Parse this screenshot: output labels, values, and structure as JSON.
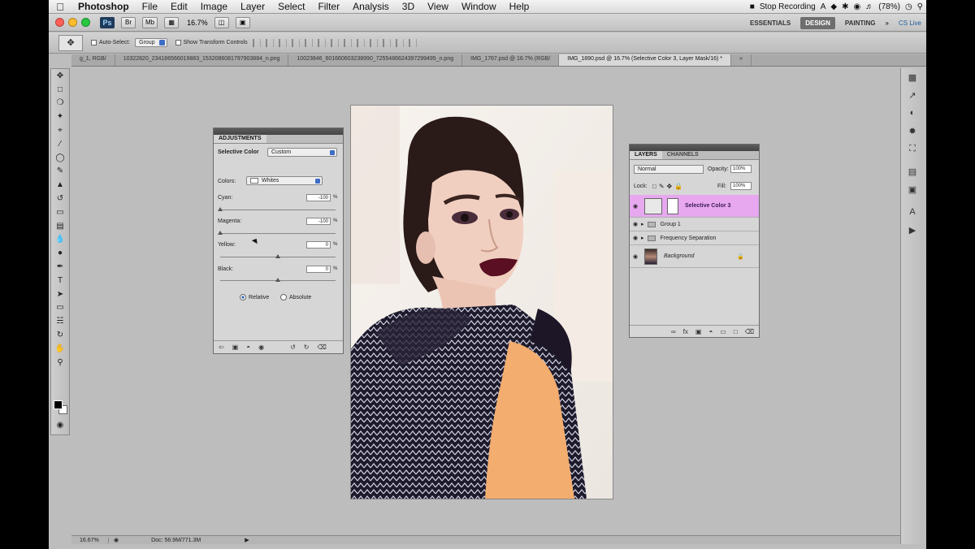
{
  "menubar": {
    "app": "Photoshop",
    "items": [
      "File",
      "Edit",
      "Image",
      "Layer",
      "Select",
      "Filter",
      "Analysis",
      "3D",
      "View",
      "Window",
      "Help"
    ],
    "status": {
      "recording": "Stop Recording",
      "battery": "(78%)"
    }
  },
  "appbar": {
    "ps": "Ps",
    "zoom": "16.7%",
    "workspaces": [
      "ESSENTIALS",
      "DESIGN",
      "PAINTING"
    ],
    "more": "»",
    "cslive": "CS Live"
  },
  "options": {
    "auto_select": "Auto-Select:",
    "group": "Group",
    "show_transform": "Show Transform Controls"
  },
  "tabs": [
    "g_1, RGB/",
    "10322820_234186566019883_1532086081797903884_n.png",
    "10023846_601660603238990_7255486624397299495_n.png",
    "IMG_1767.psd @ 16.7% (RGB/",
    "IMG_1890.psd @ 16.7% (Selective Color 3, Layer Mask/16) *"
  ],
  "adjustments": {
    "tab": "ADJUSTMENTS",
    "title": "Selective Color",
    "preset": "Custom",
    "colors_label": "Colors:",
    "colors_value": "Whites",
    "sliders": [
      {
        "label": "Cyan:",
        "value": "-100",
        "unit": "%",
        "position": 0.0
      },
      {
        "label": "Magenta:",
        "value": "-100",
        "unit": "%",
        "position": 0.0
      },
      {
        "label": "Yellow:",
        "value": "0",
        "unit": "%",
        "position": 0.5
      },
      {
        "label": "Black:",
        "value": "0",
        "unit": "%",
        "position": 0.5
      }
    ],
    "relative": "Relative",
    "absolute": "Absolute"
  },
  "layers": {
    "tabs": [
      "LAYERS",
      "CHANNELS"
    ],
    "blend": "Normal",
    "opacity_label": "Opacity:",
    "opacity": "100%",
    "lock_label": "Lock:",
    "fill_label": "Fill:",
    "fill": "100%",
    "items": [
      {
        "name": "Selective Color 3"
      },
      {
        "name": "Group 1"
      },
      {
        "name": "Frequency Separation"
      },
      {
        "name": "Background"
      }
    ]
  },
  "status": {
    "zoom": "16.67%",
    "doc": "Doc: 56.9M/771.3M"
  },
  "colors": {
    "selected_layer": "#e7a8f0",
    "accent": "#3d6ec6"
  }
}
